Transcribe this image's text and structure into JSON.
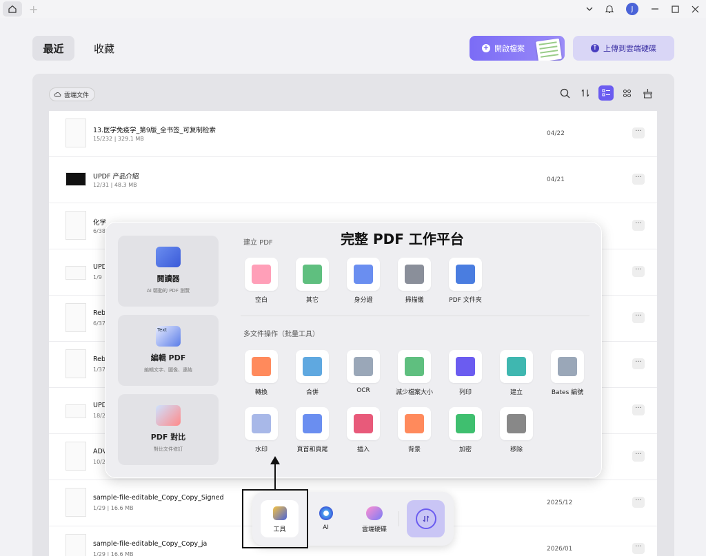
{
  "titlebar": {
    "avatar_letter": "J"
  },
  "header": {
    "tab_recent": "最近",
    "tab_favorites": "收藏",
    "open_button": "開啟檔案",
    "upload_button": "上傳到雲端硬碟"
  },
  "panel": {
    "cloud_chip": "雲端文件"
  },
  "files": [
    {
      "name": "13.医学免疫学_第9版_全书签_可复制检索",
      "meta": "15/232 | 329.1 MB",
      "date": "04/22"
    },
    {
      "name": "UPDF 产品介紹",
      "meta": "12/31 | 48.3 MB",
      "date": "04/21"
    },
    {
      "name": "化学",
      "meta": "6/38",
      "date": ""
    },
    {
      "name": "UPD",
      "meta": "1/9",
      "date": ""
    },
    {
      "name": "Reb",
      "meta": "6/37",
      "date": ""
    },
    {
      "name": "Reb",
      "meta": "1/37",
      "date": ""
    },
    {
      "name": "UPD",
      "meta": "18/2",
      "date": ""
    },
    {
      "name": "ADV",
      "meta": "10/2",
      "date": ""
    },
    {
      "name": "sample-file-editable_Copy_Copy_Signed",
      "meta": "1/29 | 16.6 MB",
      "date": "2025/12"
    },
    {
      "name": "sample-file-editable_Copy_Copy_ja",
      "meta": "1/29 | 16.6 MB",
      "date": "2026/01"
    }
  ],
  "more_glyph": "···",
  "card": {
    "title": "完整 PDF 工作平台",
    "side": [
      {
        "title": "閱讀器",
        "sub": "AI 驅動的 PDF 瀏覽"
      },
      {
        "title": "編輯 PDF",
        "sub": "編輯文字、圖像、連結"
      },
      {
        "title": "PDF 對比",
        "sub": "對比文件修訂"
      }
    ],
    "create_label": "建立 PDF",
    "create_tools": [
      "空白",
      "其它",
      "身分證",
      "掃描儀",
      "PDF 文件夾"
    ],
    "batch_label": "多文件操作（批量工具）",
    "batch_tools": [
      "轉換",
      "合併",
      "OCR",
      "減少檔案大小",
      "列印",
      "建立",
      "Bates 編號",
      "水印",
      "頁首和頁尾",
      "插入",
      "背景",
      "加密",
      "移除"
    ],
    "side_icon_text": "Text"
  },
  "dock": {
    "tools": "工具",
    "ai": "AI",
    "cloud": "雲端硬碟"
  },
  "colors": {
    "accent": "#6b5cf0",
    "upload_bg": "#d9d6f6"
  }
}
